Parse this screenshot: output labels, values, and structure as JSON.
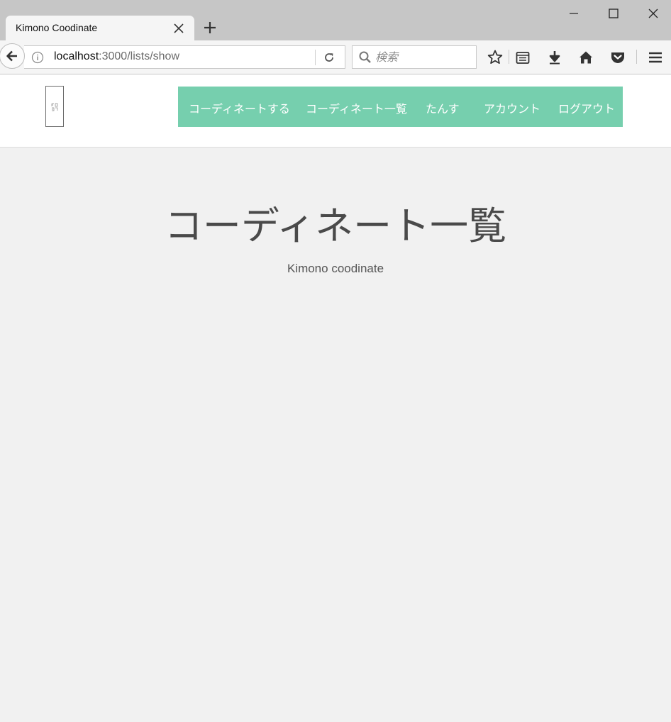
{
  "browser": {
    "tab_title": "Kimono Coodinate",
    "url_host": "localhost",
    "url_path": ":3000/lists/show",
    "search_placeholder": "検索"
  },
  "header": {
    "nav_items": [
      {
        "label": "コーディネートする"
      },
      {
        "label": "コーディネート一覧"
      },
      {
        "label": "たんす"
      },
      {
        "label": "アカウント"
      },
      {
        "label": "ログアウト"
      }
    ]
  },
  "main": {
    "title": "コーディネート一覧",
    "subtitle": "Kimono coodinate"
  },
  "colors": {
    "nav_background": "#76cfae",
    "page_background": "#f1f1f1"
  }
}
